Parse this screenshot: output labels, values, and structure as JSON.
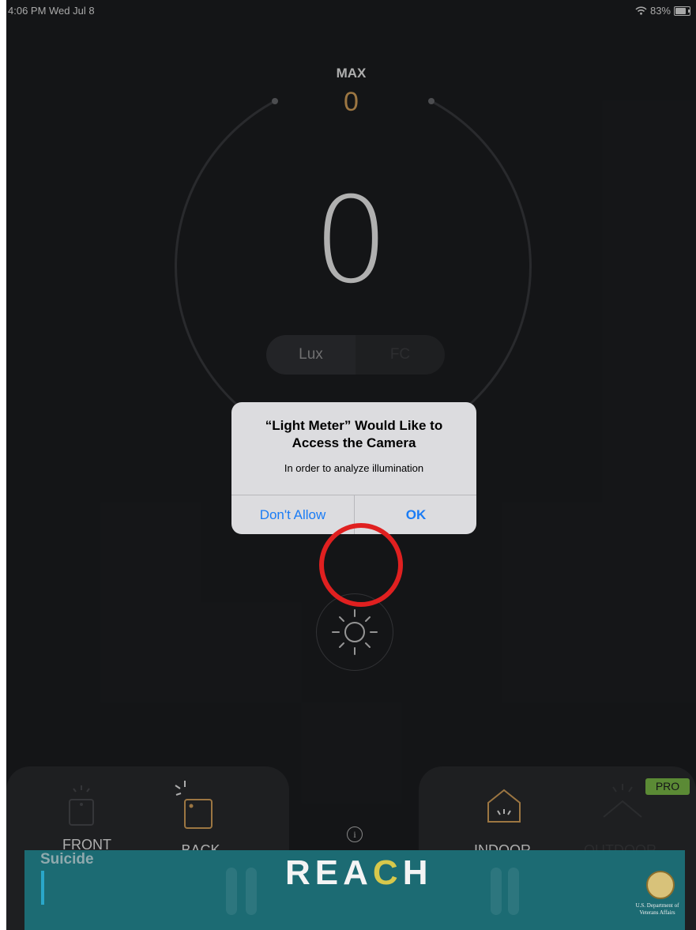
{
  "status_bar": {
    "time": "4:06 PM  Wed Jul 8",
    "battery": "83%"
  },
  "meter": {
    "max_label": "MAX",
    "max_value": "0",
    "reading": "0",
    "units": [
      "Lux",
      "FC"
    ],
    "selected_unit": "Lux"
  },
  "alert": {
    "title": "“Light Meter” Would Like to Access the Camera",
    "message": "In order to analyze illumination",
    "deny_label": "Don't Allow",
    "ok_label": "OK"
  },
  "modes": {
    "camera": [
      "FRONT",
      "BACK"
    ],
    "environment": [
      "INDOOR",
      "OUTDOOR"
    ],
    "pro_badge": "PRO",
    "info_glyph": "i"
  },
  "ad": {
    "title_prefix": "REA",
    "title_highlight": "C",
    "title_suffix": "H",
    "side_text": "Suicide",
    "logo_text": "U.S. Department of Veterans Affairs"
  },
  "colors": {
    "accent_gold": "#d9a45c",
    "ios_blue": "#1a7cf5",
    "pro_green": "#7fbf4a",
    "annotation_red": "#e02020"
  },
  "icons": [
    "wifi-icon",
    "battery-icon",
    "flash-icon",
    "front-camera-icon",
    "back-camera-icon",
    "indoor-icon",
    "outdoor-icon",
    "info-icon"
  ]
}
